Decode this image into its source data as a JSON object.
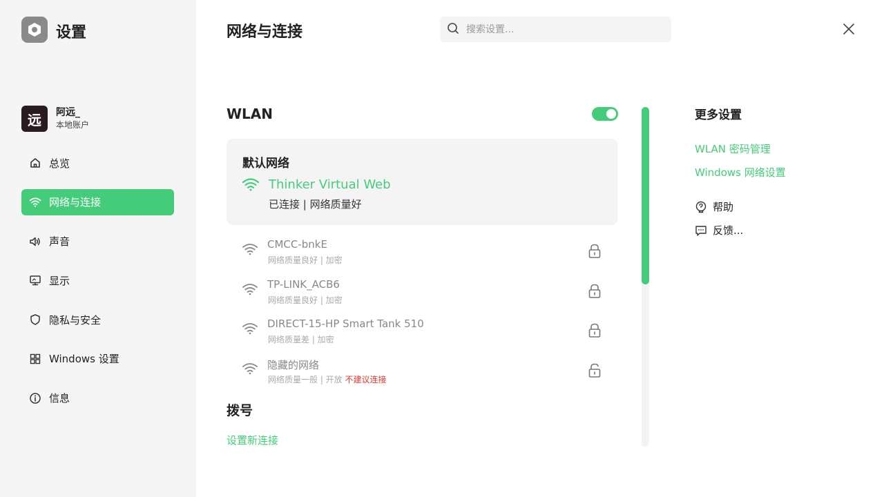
{
  "app": {
    "title": "设置"
  },
  "user": {
    "avatar_text": "远",
    "name": "阿远_",
    "account_type": "本地账户"
  },
  "sidebar": {
    "items": [
      {
        "label": "总览",
        "icon": "home-icon",
        "active": false
      },
      {
        "label": "网络与连接",
        "icon": "wifi-icon",
        "active": true
      },
      {
        "label": "声音",
        "icon": "speaker-icon",
        "active": false
      },
      {
        "label": "显示",
        "icon": "monitor-icon",
        "active": false
      },
      {
        "label": "隐私与安全",
        "icon": "shield-icon",
        "active": false
      },
      {
        "label": "Windows 设置",
        "icon": "windows-icon",
        "active": false
      },
      {
        "label": "信息",
        "icon": "info-icon",
        "active": false
      }
    ]
  },
  "header": {
    "title": "网络与连接",
    "search_placeholder": "搜索设置..."
  },
  "wlan": {
    "title": "WLAN",
    "enabled": true,
    "default": {
      "label": "默认网络",
      "ssid": "Thinker Virtual Web",
      "status": "已连接 | 网络质量好"
    },
    "networks": [
      {
        "ssid": "CMCC-bnkE",
        "sub": "网络质量良好 | 加密",
        "warning": "",
        "locked": true
      },
      {
        "ssid": "TP-LINK_ACB6",
        "sub": "网络质量良好 | 加密",
        "warning": "",
        "locked": true
      },
      {
        "ssid": "DIRECT-15-HP Smart Tank 510",
        "sub": "网络质量差 | 加密",
        "warning": "",
        "locked": true
      },
      {
        "ssid": "隐藏的网络",
        "sub": "网络质量一般 | 开放",
        "warning": "不建议连接",
        "locked": false
      }
    ]
  },
  "dial": {
    "title": "拨号",
    "link": "设置新连接"
  },
  "more": {
    "title": "更多设置",
    "links": [
      "WLAN 密码管理",
      "Windows 网络设置"
    ],
    "items": [
      {
        "label": "帮助",
        "icon": "help-icon"
      },
      {
        "label": "反馈...",
        "icon": "feedback-icon"
      }
    ]
  },
  "colors": {
    "accent": "#45cc7a",
    "warning": "#e53935",
    "sidebar_bg": "#f5f5f5",
    "card_bg": "#f4f4f4"
  }
}
